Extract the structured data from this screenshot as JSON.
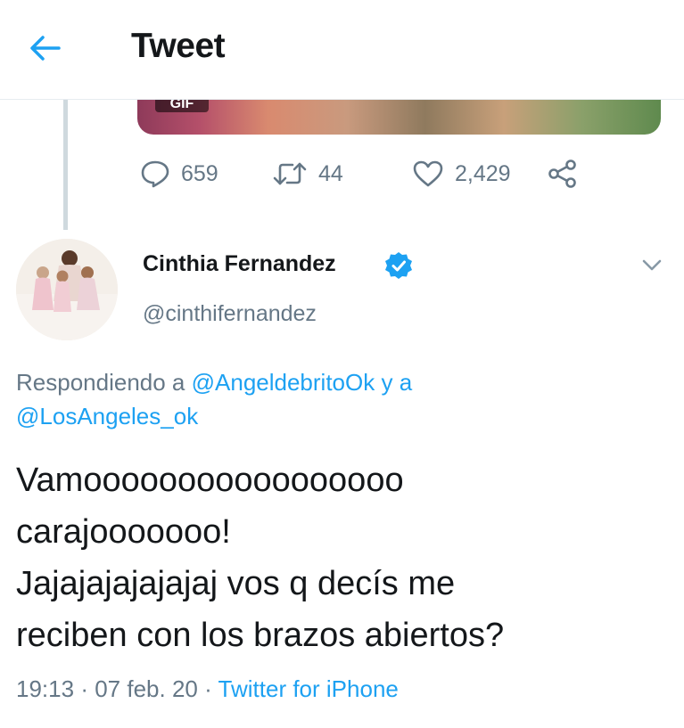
{
  "header": {
    "title": "Tweet",
    "back_icon": "back-arrow-icon",
    "accent": "#1da1f2"
  },
  "previous_tweet": {
    "media_badge": "GIF",
    "actions": {
      "reply_count": "659",
      "retweet_count": "44",
      "like_count": "2,429"
    }
  },
  "tweet": {
    "author_name": "Cinthia Fernandez",
    "author_handle": "@cinthifernandez",
    "reply_prefix": "Respondiendo a",
    "mention_1": "@AngeldebritoOk",
    "reply_joiner": "y a",
    "mention_2": "@LosAngeles_ok",
    "text": "Vamooooooooooooooooo\ncarajooooooo!\nJajajajajajajaj vos q decís me\nreciben con los brazos abiertos?",
    "time": "19:13",
    "separator": "·",
    "date": "07 feb. 20",
    "source": "Twitter for iPhone"
  }
}
